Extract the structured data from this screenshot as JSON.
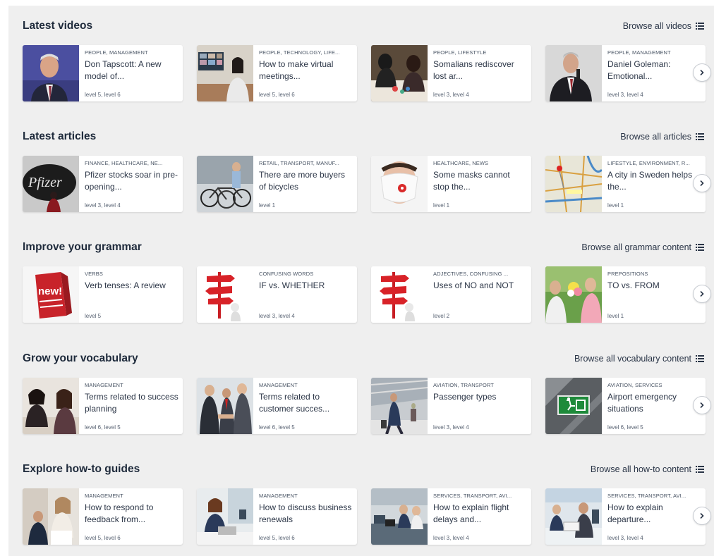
{
  "sections": [
    {
      "title": "Latest videos",
      "browse": "Browse all videos",
      "cards": [
        {
          "cat": "PEOPLE, MANAGEMENT",
          "title": "Don Tapscott: A new model of...",
          "level": "level 5, level 6"
        },
        {
          "cat": "PEOPLE, TECHNOLOGY, LIFE...",
          "title": "How to make virtual meetings...",
          "level": "level 5, level 6"
        },
        {
          "cat": "PEOPLE, LIFESTYLE",
          "title": "Somalians rediscover lost ar...",
          "level": "level 3, level 4"
        },
        {
          "cat": "PEOPLE, MANAGEMENT",
          "title": "Daniel Goleman: Emotional...",
          "level": "level 3, level 4"
        }
      ]
    },
    {
      "title": "Latest articles",
      "browse": "Browse all articles",
      "cards": [
        {
          "cat": "FINANCE, HEALTHCARE, NE...",
          "title": "Pfizer stocks soar in pre-opening...",
          "level": "level 3, level 4",
          "thumb_text": "Pfizer"
        },
        {
          "cat": "RETAIL, TRANSPORT, MANUF...",
          "title": "There are more buyers of bicycles",
          "level": "level 1"
        },
        {
          "cat": "HEALTHCARE, NEWS",
          "title": "Some masks cannot stop the...",
          "level": "level 1"
        },
        {
          "cat": "LIFESTYLE, ENVIRONMENT, R...",
          "title": "A city in Sweden helps the...",
          "level": "level 1"
        }
      ]
    },
    {
      "title": "Improve your grammar",
      "browse": "Browse all grammar content",
      "cards": [
        {
          "cat": "VERBS",
          "title": "Verb tenses: A review",
          "level": "level 5",
          "thumb_text": "new!"
        },
        {
          "cat": "CONFUSING WORDS",
          "title": "IF vs. WHETHER",
          "level": "level 3, level 4"
        },
        {
          "cat": "ADJECTIVES, CONFUSING ...",
          "title": "Uses of NO and NOT",
          "level": "level 2"
        },
        {
          "cat": "PREPOSITIONS",
          "title": "TO vs. FROM",
          "level": "level 1"
        }
      ]
    },
    {
      "title": "Grow your vocabulary",
      "browse": "Browse all vocabulary content",
      "cards": [
        {
          "cat": "MANAGEMENT",
          "title": "Terms related to success planning",
          "level": "level 6, level 5"
        },
        {
          "cat": "MANAGEMENT",
          "title": "Terms related to customer succes...",
          "level": "level 6, level 5"
        },
        {
          "cat": "AVIATION, TRANSPORT",
          "title": "Passenger types",
          "level": "level 3, level 4"
        },
        {
          "cat": "AVIATION, SERVICES",
          "title": "Airport emergency situations",
          "level": "level 6, level 5"
        }
      ]
    },
    {
      "title": "Explore how-to guides",
      "browse": "Browse all how-to content",
      "cards": [
        {
          "cat": "MANAGEMENT",
          "title": "How to respond to feedback from...",
          "level": "level 5, level 6"
        },
        {
          "cat": "MANAGEMENT",
          "title": "How to discuss business renewals",
          "level": "level 5, level 6"
        },
        {
          "cat": "SERVICES, TRANSPORT, AVI...",
          "title": "How to explain flight delays and...",
          "level": "level 3, level 4"
        },
        {
          "cat": "SERVICES, TRANSPORT, AVI...",
          "title": "How to explain departure...",
          "level": "level 3, level 4"
        }
      ]
    }
  ],
  "colors": {
    "panel": "#efefef",
    "heading": "#1e2a3b",
    "card": "#ffffff"
  }
}
